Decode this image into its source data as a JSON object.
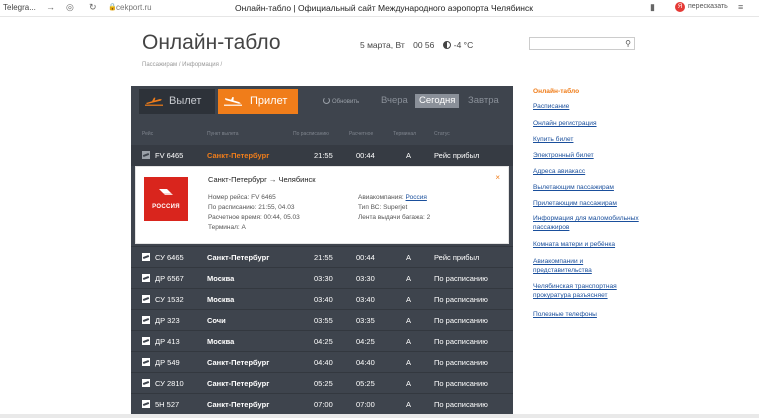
{
  "browser": {
    "tab_label": "Telegra...",
    "url": "cekport.ru",
    "page_title": "Онлайн-табло | Официальный сайт Международного аэропорта Челябинск",
    "ext_badge": "Я",
    "ext_label": "пересказать"
  },
  "header": {
    "title": "Онлайн-табло",
    "date": "5 марта, Вт",
    "time": "00 56",
    "temperature": "-4 °C",
    "breadcrumb": "Пассажирам / Информация /",
    "search_placeholder": ""
  },
  "board": {
    "tab_departure": "Вылет",
    "tab_arrival": "Прилет",
    "refresh_label": "Обновить",
    "days": [
      "Вчера",
      "Сегодня",
      "Завтра"
    ],
    "active_day": "Сегодня",
    "columns": [
      "Рейс",
      "Пункт вылета",
      "По расписанию",
      "Расчетное",
      "Терминал",
      "Статус"
    ],
    "selected_flight": {
      "flight": "FV 6465",
      "city": "Санкт-Петербург",
      "sched": "21:55",
      "est": "00:44",
      "term": "A",
      "status": "Рейс прибыл"
    },
    "detail": {
      "airline_logo_text": "РОССИЯ",
      "route": "Санкт-Петербург → Челябинск",
      "flight_number": "Номер рейса: FV 6465",
      "scheduled": "По расписанию: 21:55, 04.03",
      "estimated": "Расчетное время: 00:44, 05.03",
      "terminal": "Терминал: A",
      "airline_label": "Авиакомпания:",
      "airline_name": "Россия",
      "aircraft": "Тип ВС: Superjet",
      "baggage": "Лента выдачи багажа: 2",
      "close": "×"
    },
    "rows": [
      {
        "flight": "СУ 6465",
        "city": "Санкт-Петербург",
        "sched": "21:55",
        "est": "00:44",
        "term": "A",
        "status": "Рейс прибыл"
      },
      {
        "flight": "ДР 6567",
        "city": "Москва",
        "sched": "03:30",
        "est": "03:30",
        "term": "A",
        "status": "По расписанию"
      },
      {
        "flight": "СУ 1532",
        "city": "Москва",
        "sched": "03:40",
        "est": "03:40",
        "term": "A",
        "status": "По расписанию"
      },
      {
        "flight": "ДР 323",
        "city": "Сочи",
        "sched": "03:55",
        "est": "03:35",
        "term": "A",
        "status": "По расписанию"
      },
      {
        "flight": "ДР 413",
        "city": "Москва",
        "sched": "04:25",
        "est": "04:25",
        "term": "A",
        "status": "По расписанию"
      },
      {
        "flight": "ДР 549",
        "city": "Санкт-Петербург",
        "sched": "04:40",
        "est": "04:40",
        "term": "A",
        "status": "По расписанию"
      },
      {
        "flight": "СУ 2810",
        "city": "Санкт-Петербург",
        "sched": "05:25",
        "est": "05:25",
        "term": "A",
        "status": "По расписанию"
      },
      {
        "flight": "5Н 527",
        "city": "Санкт-Петербург",
        "sched": "07:00",
        "est": "07:00",
        "term": "A",
        "status": "По расписанию"
      }
    ]
  },
  "sidebar": {
    "items": [
      {
        "label": "Онлайн-табло",
        "active": true
      },
      {
        "label": "Расписание"
      },
      {
        "label": "Онлайн регистрация"
      },
      {
        "label": "Купить билет"
      },
      {
        "label": "Электронный билет"
      },
      {
        "label": "Адреса авиакасс"
      },
      {
        "label": "Вылетающим пассажирам"
      },
      {
        "label": "Прилетающим пассажирам"
      },
      {
        "label": "Информация для маломобильных пассажиров"
      },
      {
        "label": "Комната матери и ребёнка"
      },
      {
        "label": "Авиакомпании и представительства"
      },
      {
        "label": "Челябинская транспортная прокуратура разъясняет"
      },
      {
        "label": "Полезные телефоны"
      }
    ]
  },
  "colors": {
    "accent": "#f07d1a",
    "board_bg": "#3e444d",
    "link": "#1a4f9c",
    "airline_red": "#d9251d"
  }
}
